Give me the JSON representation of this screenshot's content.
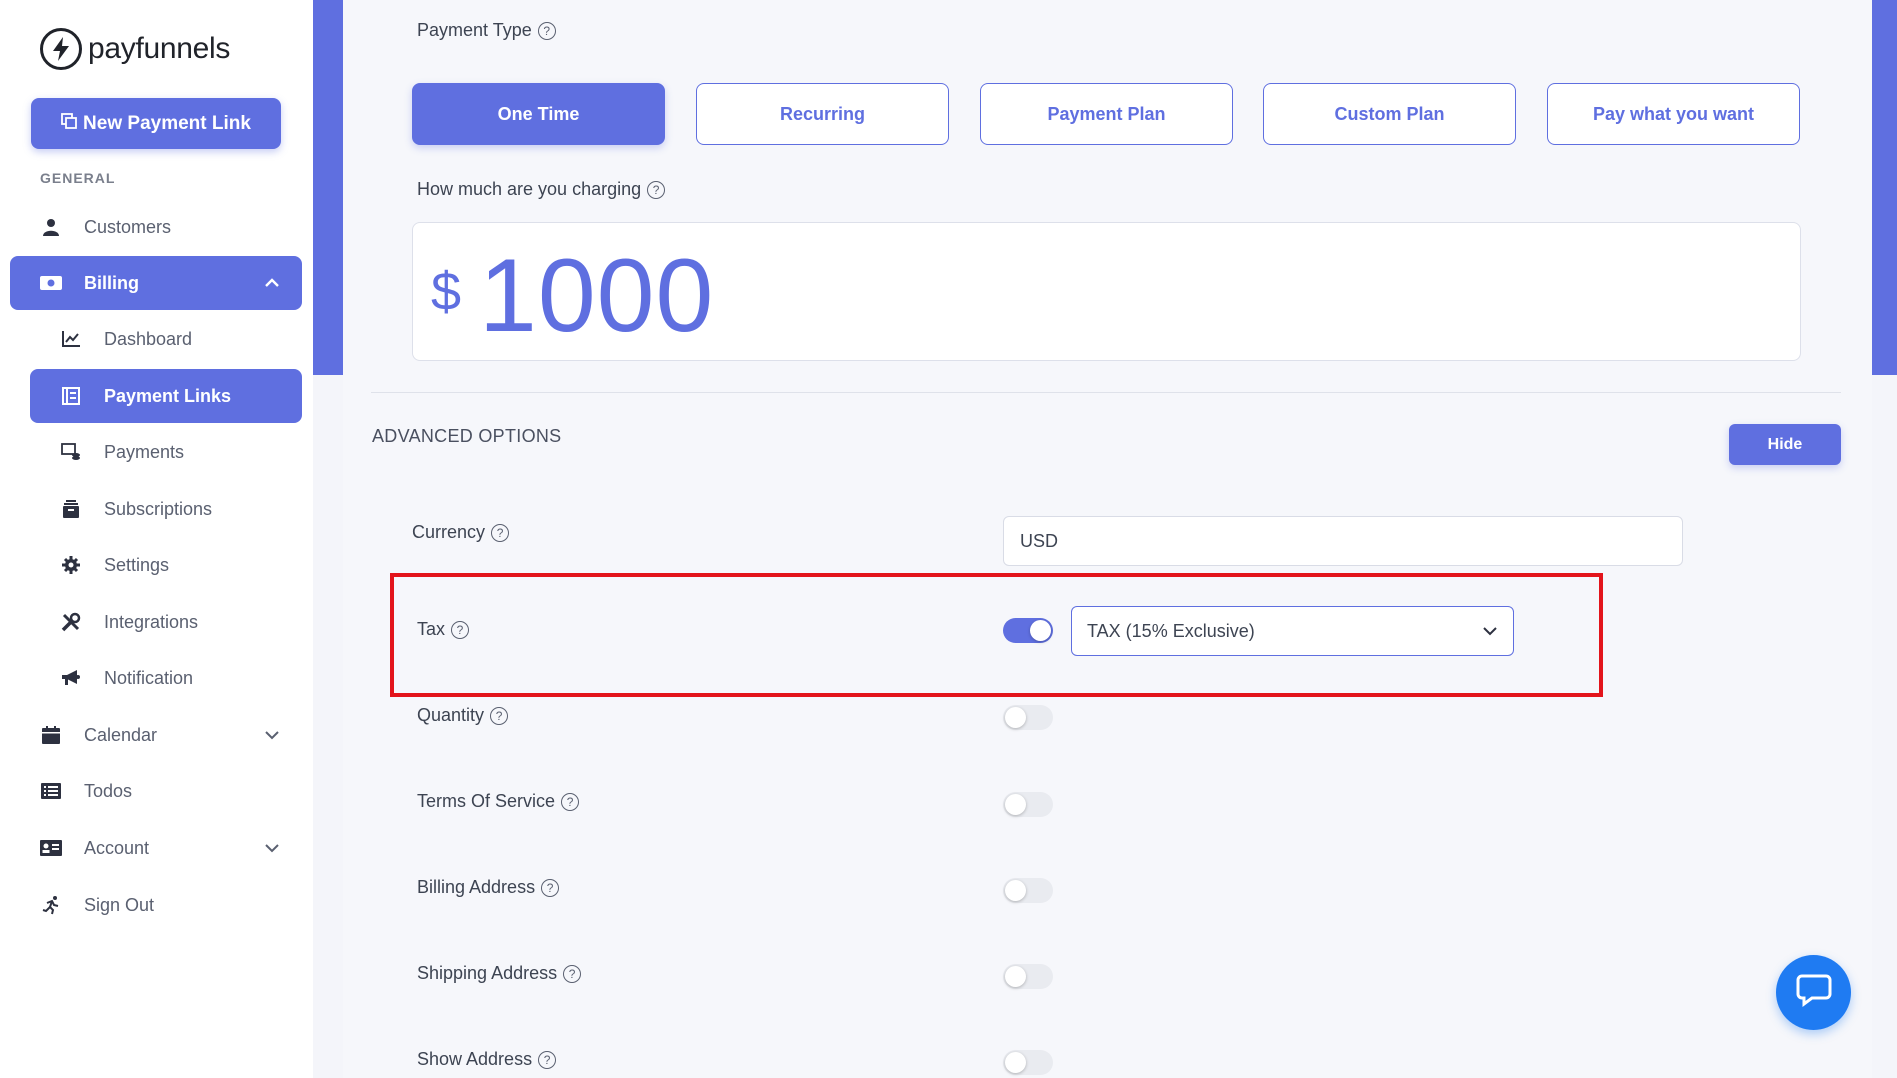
{
  "brand": {
    "name": "payfunnels",
    "accent": "#5f6fe0",
    "icon": "bolt-icon"
  },
  "sidebar": {
    "new_link_label": "New Payment Link",
    "section_general": "GENERAL",
    "items": [
      {
        "label": "Customers",
        "icon": "user-icon"
      },
      {
        "label": "Billing",
        "icon": "money-icon"
      },
      {
        "label": "Dashboard",
        "icon": "chart-line-icon"
      },
      {
        "label": "Payment Links",
        "icon": "link-doc-icon"
      },
      {
        "label": "Payments",
        "icon": "payments-icon"
      },
      {
        "label": "Subscriptions",
        "icon": "archive-icon"
      },
      {
        "label": "Settings",
        "icon": "gear-icon"
      },
      {
        "label": "Integrations",
        "icon": "tools-icon"
      },
      {
        "label": "Notification",
        "icon": "megaphone-icon"
      },
      {
        "label": "Calendar",
        "icon": "calendar-icon"
      },
      {
        "label": "Todos",
        "icon": "list-icon"
      },
      {
        "label": "Account",
        "icon": "id-card-icon"
      },
      {
        "label": "Sign Out",
        "icon": "running-icon"
      }
    ],
    "active_item": "Payment Links"
  },
  "form": {
    "payment_type_label": "Payment Type",
    "payment_types": [
      "One Time",
      "Recurring",
      "Payment Plan",
      "Custom Plan",
      "Pay what you want"
    ],
    "selected_payment_type": "One Time",
    "charge_label": "How much are you charging",
    "currency_symbol": "$",
    "amount": "1000"
  },
  "advanced": {
    "title": "ADVANCED OPTIONS",
    "hide_label": "Hide",
    "currency_label": "Currency",
    "currency_value": "USD",
    "tax_label": "Tax",
    "tax_enabled": true,
    "tax_value": "TAX (15% Exclusive)",
    "options": [
      {
        "label": "Quantity",
        "enabled": false
      },
      {
        "label": "Terms Of Service",
        "enabled": false
      },
      {
        "label": "Billing Address",
        "enabled": false
      },
      {
        "label": "Shipping Address",
        "enabled": false
      },
      {
        "label": "Show Address",
        "enabled": false
      }
    ]
  },
  "help_glyph": "?",
  "highlight_color": "#e3141b",
  "chat_color": "#1f7bf2"
}
